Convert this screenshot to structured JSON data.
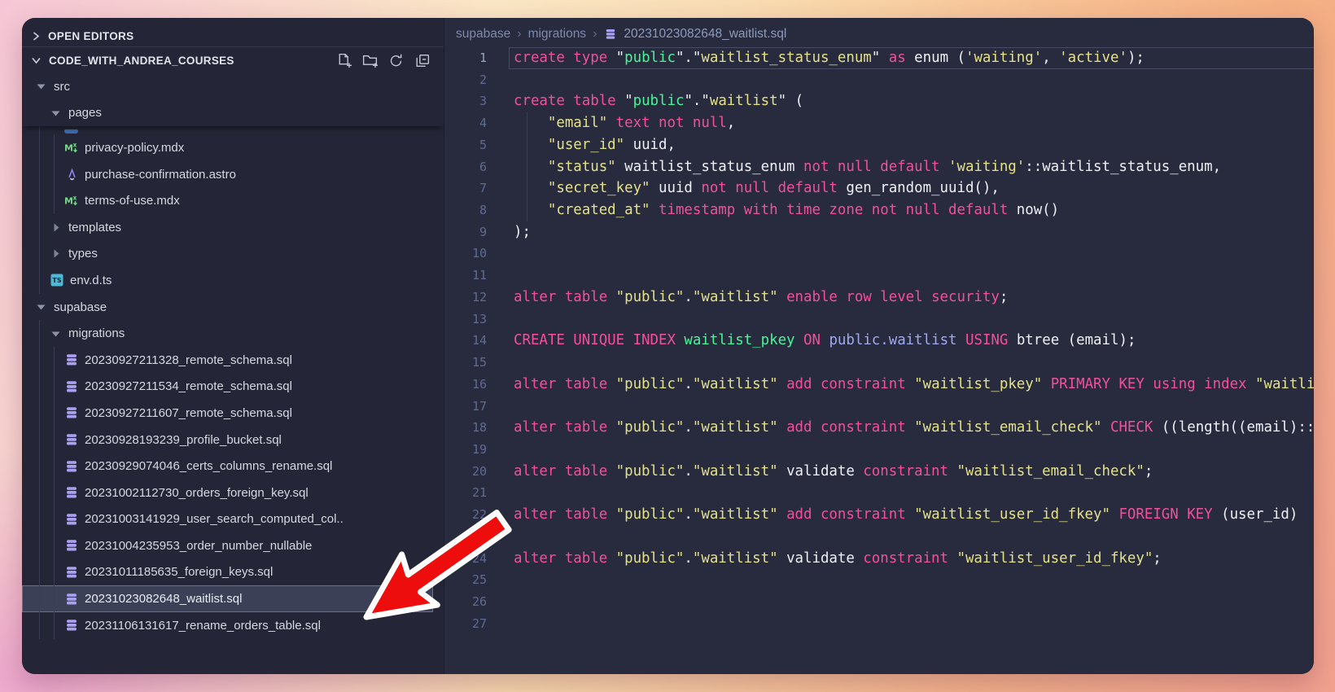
{
  "colors": {
    "keyword_pink": "#f2509e",
    "string_yellow": "#e4e18a",
    "entity_green": "#4af598",
    "reference_lavender": "#9fa9f2",
    "code_white": "#eef0f6",
    "arrow_red": "#ee0d0d",
    "arrow_outline": "#ffffff",
    "selected_row_border": "#68719a",
    "sidebar_bg": "#242637",
    "editor_bg": "#282b3d"
  },
  "sidebar": {
    "open_editors_label": "OPEN EDITORS",
    "section_title": "CODE_WITH_ANDREA_COURSES",
    "actions": [
      "new-file",
      "new-folder",
      "refresh-explorer",
      "collapse-folders"
    ],
    "tree": [
      {
        "label": "src",
        "type": "folder",
        "level": 0,
        "expanded": true,
        "sticky": true
      },
      {
        "label": "pages",
        "type": "folder",
        "level": 1,
        "expanded": true,
        "sticky": true
      },
      {
        "label": "privacy-policy.mdx",
        "icon": "mdx",
        "level": 2
      },
      {
        "label": "purchase-confirmation.astro",
        "icon": "astro",
        "level": 2
      },
      {
        "label": "terms-of-use.mdx",
        "icon": "mdx",
        "level": 2
      },
      {
        "label": "templates",
        "type": "folder",
        "level": 1,
        "expanded": false
      },
      {
        "label": "types",
        "type": "folder",
        "level": 1,
        "expanded": false
      },
      {
        "label": "env.d.ts",
        "icon": "ts",
        "level": 1
      },
      {
        "label": "supabase",
        "type": "folder",
        "level": 0,
        "expanded": true
      },
      {
        "label": "migrations",
        "type": "folder",
        "level": 1,
        "expanded": true
      },
      {
        "label": "20230927211328_remote_schema.sql",
        "icon": "sql",
        "level": 2
      },
      {
        "label": "20230927211534_remote_schema.sql",
        "icon": "sql",
        "level": 2
      },
      {
        "label": "20230927211607_remote_schema.sql",
        "icon": "sql",
        "level": 2
      },
      {
        "label": "20230928193239_profile_bucket.sql",
        "icon": "sql",
        "level": 2
      },
      {
        "label": "20230929074046_certs_columns_rename.sql",
        "icon": "sql",
        "level": 2
      },
      {
        "label": "20231002112730_orders_foreign_key.sql",
        "icon": "sql",
        "level": 2
      },
      {
        "label": "20231003141929_user_search_computed_col..",
        "icon": "sql",
        "level": 2
      },
      {
        "label": "20231004235953_order_number_nullable",
        "icon": "sql",
        "level": 2
      },
      {
        "label": "20231011185635_foreign_keys.sql",
        "icon": "sql",
        "level": 2
      },
      {
        "label": "20231023082648_waitlist.sql",
        "icon": "sql",
        "level": 2,
        "selected": true
      },
      {
        "label": "20231106131617_rename_orders_table.sql",
        "icon": "sql",
        "level": 2
      }
    ]
  },
  "editor": {
    "breadcrumb": [
      "supabase",
      "migrations"
    ],
    "file": {
      "name": "20231023082648_waitlist.sql",
      "icon": "database-icon"
    },
    "lines": [
      {
        "n": 1,
        "current": true,
        "tokens": [
          [
            "k",
            "create type "
          ],
          [
            "w",
            "\""
          ],
          [
            "g",
            "public"
          ],
          [
            "w",
            "\".\""
          ],
          [
            "y",
            "waitlist_status_enum"
          ],
          [
            "w",
            "\" "
          ],
          [
            "k",
            "as"
          ],
          [
            "w",
            " enum ("
          ],
          [
            "y",
            "'waiting'"
          ],
          [
            "w",
            ", "
          ],
          [
            "y",
            "'active'"
          ],
          [
            "w",
            ");"
          ]
        ]
      },
      {
        "n": 2,
        "tokens": []
      },
      {
        "n": 3,
        "tokens": [
          [
            "k",
            "create table "
          ],
          [
            "w",
            "\""
          ],
          [
            "g",
            "public"
          ],
          [
            "w",
            "\".\""
          ],
          [
            "y",
            "waitlist"
          ],
          [
            "w",
            "\" ("
          ]
        ]
      },
      {
        "n": 4,
        "tokens": [
          [
            "w",
            "    "
          ],
          [
            "y",
            "\"email\""
          ],
          [
            "w",
            " "
          ],
          [
            "k",
            "text not null"
          ],
          [
            "w",
            ","
          ]
        ]
      },
      {
        "n": 5,
        "tokens": [
          [
            "w",
            "    "
          ],
          [
            "y",
            "\"user_id\""
          ],
          [
            "w",
            " uuid,"
          ]
        ]
      },
      {
        "n": 6,
        "tokens": [
          [
            "w",
            "    "
          ],
          [
            "y",
            "\"status\""
          ],
          [
            "w",
            " waitlist_status_enum "
          ],
          [
            "k",
            "not null default"
          ],
          [
            "w",
            " "
          ],
          [
            "y",
            "'waiting'"
          ],
          [
            "w",
            "::waitlist_status_enum,"
          ]
        ]
      },
      {
        "n": 7,
        "tokens": [
          [
            "w",
            "    "
          ],
          [
            "y",
            "\"secret_key\""
          ],
          [
            "w",
            " uuid "
          ],
          [
            "k",
            "not null default"
          ],
          [
            "w",
            " gen_random_uuid(),"
          ]
        ]
      },
      {
        "n": 8,
        "tokens": [
          [
            "w",
            "    "
          ],
          [
            "y",
            "\"created_at\""
          ],
          [
            "w",
            " "
          ],
          [
            "k",
            "timestamp with time zone not null default"
          ],
          [
            "w",
            " now()"
          ]
        ]
      },
      {
        "n": 9,
        "tokens": [
          [
            "w",
            ");"
          ]
        ]
      },
      {
        "n": 10,
        "tokens": []
      },
      {
        "n": 11,
        "tokens": []
      },
      {
        "n": 12,
        "tokens": [
          [
            "k",
            "alter table "
          ],
          [
            "y",
            "\"public\""
          ],
          [
            "w",
            "."
          ],
          [
            "y",
            "\"waitlist\""
          ],
          [
            "w",
            " "
          ],
          [
            "k",
            "enable row level security"
          ],
          [
            "w",
            ";"
          ]
        ]
      },
      {
        "n": 13,
        "tokens": []
      },
      {
        "n": 14,
        "tokens": [
          [
            "k",
            "CREATE UNIQUE INDEX "
          ],
          [
            "g",
            "waitlist_pkey"
          ],
          [
            "w",
            " "
          ],
          [
            "k",
            "ON"
          ],
          [
            "w",
            " "
          ],
          [
            "l",
            "public.waitlist"
          ],
          [
            "w",
            " "
          ],
          [
            "k",
            "USING"
          ],
          [
            "w",
            " btree (email);"
          ]
        ]
      },
      {
        "n": 15,
        "tokens": []
      },
      {
        "n": 16,
        "tokens": [
          [
            "k",
            "alter table "
          ],
          [
            "y",
            "\"public\""
          ],
          [
            "w",
            "."
          ],
          [
            "y",
            "\"waitlist\""
          ],
          [
            "w",
            " "
          ],
          [
            "k",
            "add constraint"
          ],
          [
            "w",
            " "
          ],
          [
            "y",
            "\"waitlist_pkey\""
          ],
          [
            "w",
            " "
          ],
          [
            "k",
            "PRIMARY KEY"
          ],
          [
            "w",
            " "
          ],
          [
            "k",
            "using index"
          ],
          [
            "w",
            " "
          ],
          [
            "y",
            "\"waitlist_pkey\""
          ],
          [
            "w",
            ";"
          ]
        ]
      },
      {
        "n": 17,
        "tokens": []
      },
      {
        "n": 18,
        "tokens": [
          [
            "k",
            "alter table "
          ],
          [
            "y",
            "\"public\""
          ],
          [
            "w",
            "."
          ],
          [
            "y",
            "\"waitlist\""
          ],
          [
            "w",
            " "
          ],
          [
            "k",
            "add constraint"
          ],
          [
            "w",
            " "
          ],
          [
            "y",
            "\"waitlist_email_check\""
          ],
          [
            "w",
            " "
          ],
          [
            "k",
            "CHECK"
          ],
          [
            "w",
            " ((length((email)::text)"
          ]
        ]
      },
      {
        "n": 19,
        "tokens": []
      },
      {
        "n": 20,
        "tokens": [
          [
            "k",
            "alter table "
          ],
          [
            "y",
            "\"public\""
          ],
          [
            "w",
            "."
          ],
          [
            "y",
            "\"waitlist\""
          ],
          [
            "w",
            " validate "
          ],
          [
            "k",
            "constraint"
          ],
          [
            "w",
            " "
          ],
          [
            "y",
            "\"waitlist_email_check\""
          ],
          [
            "w",
            ";"
          ]
        ]
      },
      {
        "n": 21,
        "tokens": []
      },
      {
        "n": 22,
        "tokens": [
          [
            "k",
            "alter table "
          ],
          [
            "y",
            "\"public\""
          ],
          [
            "w",
            "."
          ],
          [
            "y",
            "\"waitlist\""
          ],
          [
            "w",
            " "
          ],
          [
            "k",
            "add constraint"
          ],
          [
            "w",
            " "
          ],
          [
            "y",
            "\"waitlist_user_id_fkey\""
          ],
          [
            "w",
            " "
          ],
          [
            "k",
            "FOREIGN KEY"
          ],
          [
            "w",
            " (user_id)"
          ]
        ]
      },
      {
        "n": 23,
        "tokens": []
      },
      {
        "n": 24,
        "tokens": [
          [
            "k",
            "alter table "
          ],
          [
            "y",
            "\"public\""
          ],
          [
            "w",
            "."
          ],
          [
            "y",
            "\"waitlist\""
          ],
          [
            "w",
            " validate "
          ],
          [
            "k",
            "constraint"
          ],
          [
            "w",
            " "
          ],
          [
            "y",
            "\"waitlist_user_id_fkey\""
          ],
          [
            "w",
            ";"
          ]
        ]
      },
      {
        "n": 25,
        "tokens": []
      },
      {
        "n": 26,
        "tokens": []
      },
      {
        "n": 27,
        "tokens": []
      }
    ]
  },
  "annotation": {
    "type": "arrow",
    "points_to": "20231023082648_waitlist.sql",
    "color": "#ee0d0d",
    "outline": "#ffffff"
  }
}
